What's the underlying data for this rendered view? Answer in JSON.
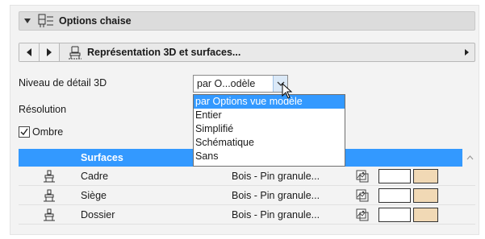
{
  "header": {
    "title": "Options chaise",
    "icon": "chair-settings-icon"
  },
  "nav": {
    "title": "Représentation 3D et surfaces...",
    "icon": "chair-3d-icon"
  },
  "fields": {
    "lod_label": "Niveau de détail 3D",
    "lod_value": "par O...odèle",
    "resolution_label": "Résolution",
    "shadow_label": "Ombre",
    "shadow_checked": true
  },
  "dropdown": {
    "options": [
      "par Options vue modèle",
      "Entier",
      "Simplifié",
      "Schématique",
      "Sans"
    ],
    "selected_index": 0
  },
  "table": {
    "header": "Surfaces",
    "rows": [
      {
        "name": "Cadre",
        "material": "Bois - Pin granule...",
        "color": "#f1d9b5"
      },
      {
        "name": "Siège",
        "material": "Bois - Pin granule...",
        "color": "#f1d9b5"
      },
      {
        "name": "Dossier",
        "material": "Bois - Pin granule...",
        "color": "#f1d9b5"
      }
    ]
  },
  "colors": {
    "accent": "#3399ff",
    "panel": "#f3f3f3"
  }
}
